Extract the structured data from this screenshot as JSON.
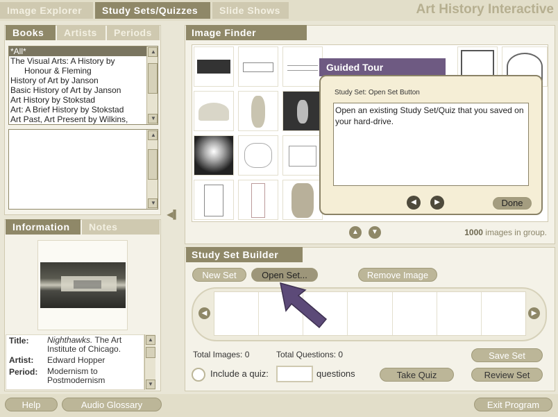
{
  "app": {
    "title": "Art History Interactive",
    "tabs": [
      "Image Explorer",
      "Study Sets/Quizzes",
      "Slide Shows"
    ]
  },
  "left": {
    "tabs": [
      "Books",
      "Artists",
      "Periods"
    ],
    "book_list": [
      "*All*",
      "The Visual Arts: A History by",
      "Honour & Fleming",
      "History of Art by Janson",
      "Basic History of Art by Janson",
      "Art History by Stokstad",
      "Art: A Brief History by Stokstad",
      "Art Past, Art Present by Wilkins,"
    ],
    "info_tabs": [
      "Information",
      "Notes"
    ],
    "info": {
      "title_label": "Title:",
      "title_value_italic": "Nighthawks.",
      "title_value_rest": "The Art Institute of Chicago.",
      "artist_label": "Artist:",
      "artist_value": "Edward Hopper",
      "period_label": "Period:",
      "period_value": "Modernism to Postmodernism"
    }
  },
  "finder": {
    "title": "Image Finder",
    "count": "1000",
    "count_suffix": "images in group."
  },
  "tour": {
    "title": "Guided Tour",
    "subtitle": "Study Set: Open Set Button",
    "body": "Open an existing Study Set/Quiz that you saved on your hard-drive.",
    "done": "Done"
  },
  "builder": {
    "title": "Study Set Builder",
    "new_set": "New Set",
    "open_set": "Open Set...",
    "remove_image": "Remove Image",
    "total_images": "Total Images: 0",
    "total_questions": "Total Questions: 0",
    "include_quiz": "Include a quiz:",
    "questions": "questions",
    "save_set": "Save Set",
    "take_quiz": "Take Quiz",
    "review_set": "Review Set"
  },
  "footer": {
    "help": "Help",
    "glossary": "Audio Glossary",
    "exit": "Exit Program"
  },
  "colors": {
    "accent": "#8f8868",
    "tour_header": "#6e5a82",
    "arrow": "#5c4a78"
  }
}
